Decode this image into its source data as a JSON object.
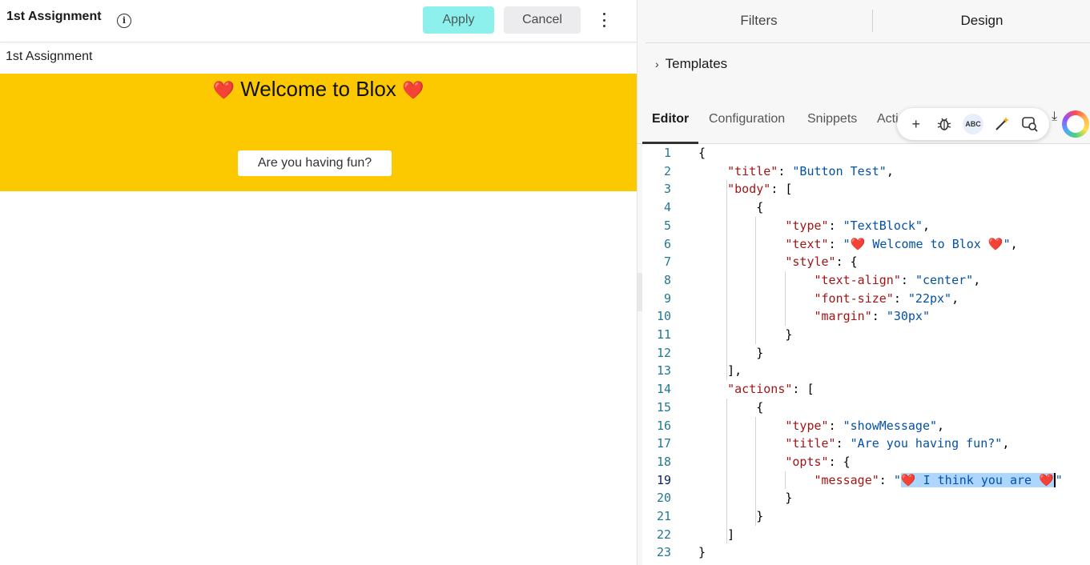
{
  "header": {
    "title": "1st Assignment",
    "apply_label": "Apply",
    "cancel_label": "Cancel"
  },
  "preview": {
    "card_label": "1st Assignment",
    "banner_text": "Welcome to Blox",
    "heart_glyph": "❤️",
    "button_label": "Are you having fun?",
    "banner_color": "#fcc900"
  },
  "right_panel": {
    "tabs": [
      "Filters",
      "Design"
    ],
    "active_tab": "Design",
    "templates_label": "Templates",
    "editor_tabs": [
      "Editor",
      "Configuration",
      "Snippets",
      "Acti"
    ],
    "active_editor_tab": "Editor",
    "toolbar_icons": [
      "plus-icon",
      "bug-icon",
      "spellcheck-icon",
      "magic-wand-icon",
      "search-chat-icon"
    ]
  },
  "code": {
    "current_line": 19,
    "lines": [
      "{",
      "    \"title\": \"Button Test\",",
      "    \"body\": [",
      "        {",
      "            \"type\": \"TextBlock\",",
      "            \"text\": \"❤️ Welcome to Blox ❤️\",",
      "            \"style\": {",
      "                \"text-align\": \"center\",",
      "                \"font-size\": \"22px\",",
      "                \"margin\": \"30px\"",
      "            }",
      "        }",
      "    ],",
      "    \"actions\": [",
      "        {",
      "            \"type\": \"showMessage\",",
      "            \"title\": \"Are you having fun?\",",
      "            \"opts\": {",
      "                \"message\": \"❤️ I think you are ❤️\"",
      "            }",
      "        }",
      "    ]",
      "}"
    ]
  }
}
